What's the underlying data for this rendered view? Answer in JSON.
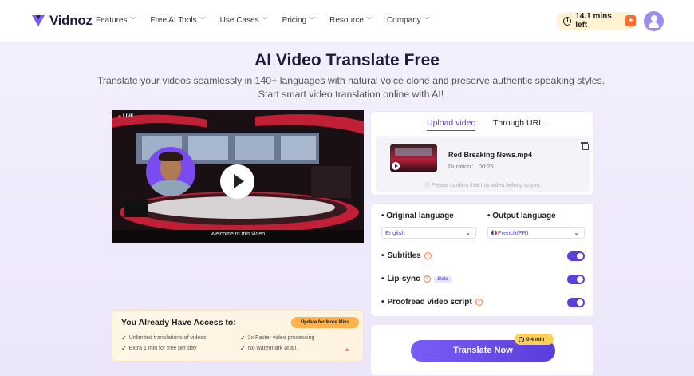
{
  "nav": {
    "logo_text": "Vidnoz",
    "menu": [
      {
        "label": "Features"
      },
      {
        "label": "Free AI Tools"
      },
      {
        "label": "Use Cases"
      },
      {
        "label": "Pricing"
      },
      {
        "label": "Resource"
      },
      {
        "label": "Company"
      }
    ],
    "mins_left": "14.1 mins left",
    "plus_glyph": "+"
  },
  "hero": {
    "title": "AI Video Translate Free",
    "subtitle": "Translate your videos seamlessly in 140+ languages with natural voice clone and preserve authentic speaking styles. Start smart video translation online with AI!"
  },
  "video": {
    "live_label": "LIVE",
    "caption": "Welcome to this video"
  },
  "access": {
    "title": "You Already Have Access to:",
    "update_button": "Update for More Mins",
    "features": [
      "Unlimited translations of videos",
      "2x Faster video processing",
      "Extra 1 min for free per day",
      "No watermark at all"
    ]
  },
  "upload": {
    "tab_upload": "Upload video",
    "tab_url": "Through URL",
    "file_name": "Red Breaking News.mp4",
    "duration": "Duration： 00:25",
    "confirm_text": "Please confirm that this video belong to you."
  },
  "language": {
    "original_label": "Original language",
    "output_label": "Output language",
    "original_value": "English",
    "output_value": "French(FR)",
    "subtitles_label": "Subtitles",
    "lipsync_label": "Lip-sync",
    "beta_label": "Beta",
    "proofread_label": "Proofread video script",
    "toggles": {
      "subtitles": true,
      "lipsync": true,
      "proofread": true
    }
  },
  "translate": {
    "button": "Translate Now",
    "time_badge": "0.4 min"
  },
  "colors": {
    "accent": "#5d3fdc",
    "badge": "#fff3d4",
    "orange": "#ff6a2a"
  }
}
